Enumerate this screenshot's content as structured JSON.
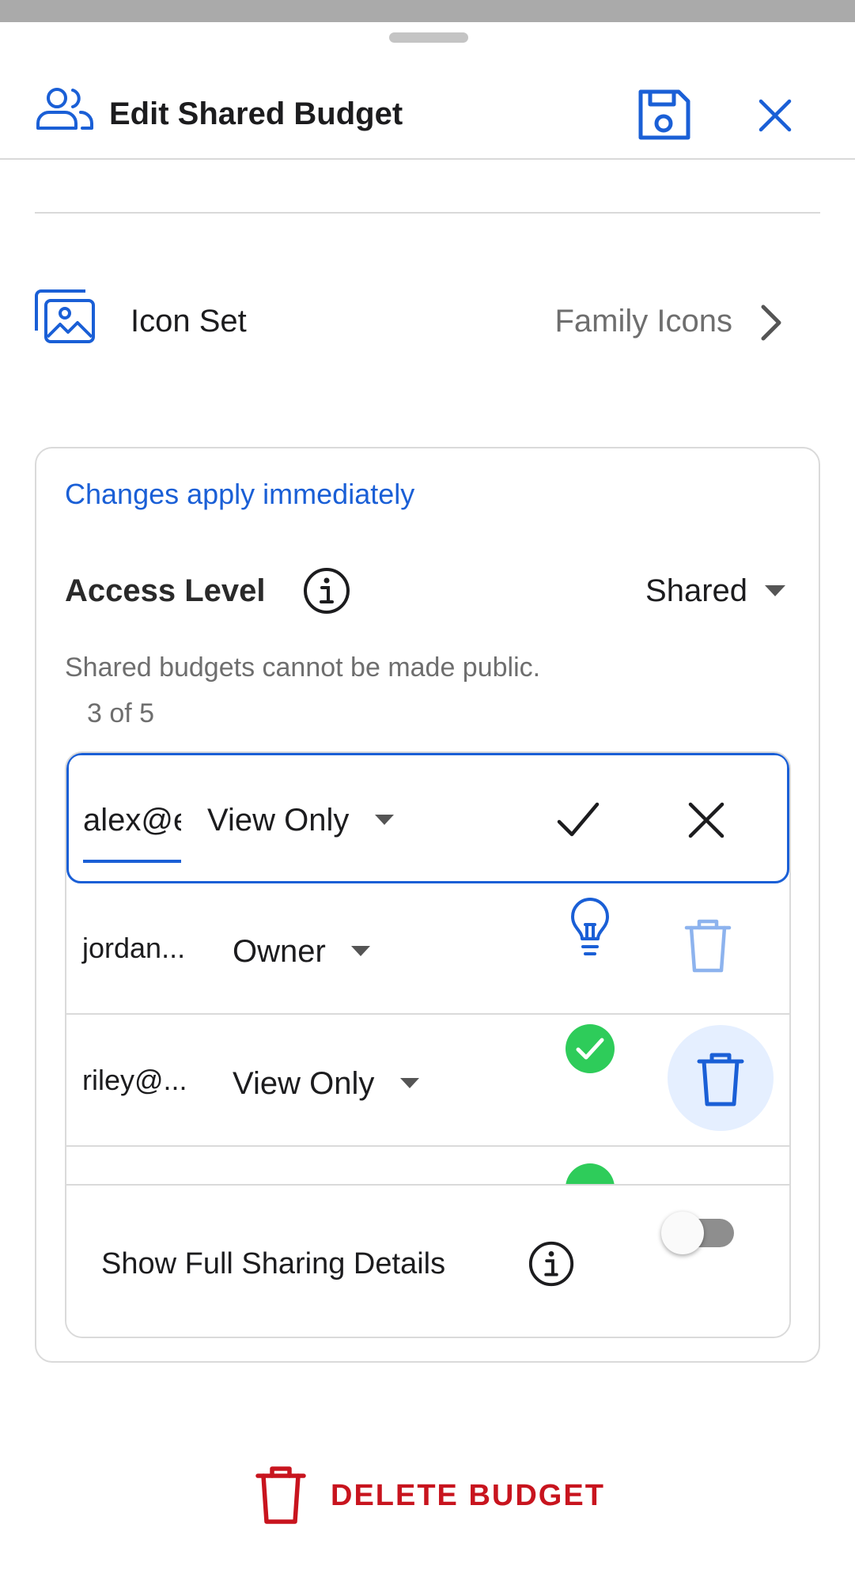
{
  "header": {
    "title": "Edit Shared Budget",
    "icon": "people-icon",
    "save_icon": "floppy-disk-icon",
    "close_icon": "close-icon"
  },
  "icon_set": {
    "label": "Icon Set",
    "value": "Family Icons",
    "icon": "images-icon"
  },
  "card": {
    "notice": "Changes apply immediately",
    "access_level": {
      "label": "Access Level",
      "value": "Shared",
      "hint": "Shared budgets cannot be made public."
    },
    "member_count": "3 of 5",
    "members": [
      {
        "email": "alex@e",
        "role": "View Only",
        "state": "editing"
      },
      {
        "email": "jordan...",
        "role": "Owner",
        "status_icon": "lightbulb-icon"
      },
      {
        "email": "riley@...",
        "role": "View Only",
        "status_icon": "check-circle-icon"
      }
    ],
    "details": {
      "label": "Show Full Sharing Details",
      "toggle_on": false
    }
  },
  "delete": {
    "label": "DELETE BUDGET",
    "icon": "trash-icon"
  },
  "colors": {
    "accent": "#1a5fd6",
    "danger": "#c8141e",
    "success": "#2ecc5a",
    "muted_text": "#6e6e6e"
  }
}
